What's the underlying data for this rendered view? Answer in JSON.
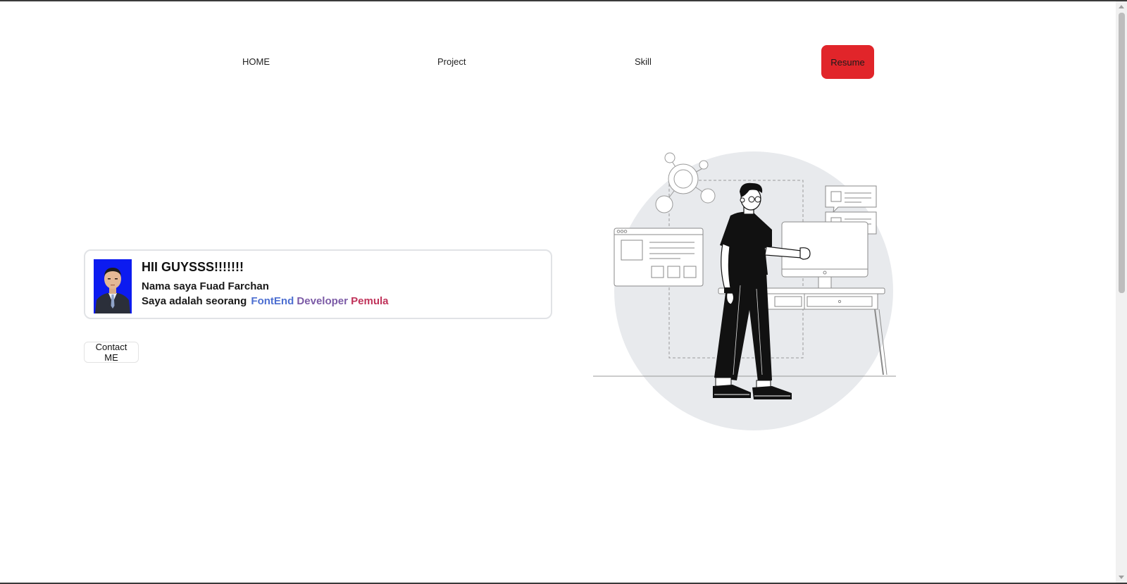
{
  "nav": {
    "home_label": "HOME",
    "project_label": "Project",
    "skill_label": "Skill",
    "resume_label": "Resume"
  },
  "intro": {
    "greeting": "HII GUYSSS!!!!!!!",
    "name_line": "Nama saya Fuad Farchan",
    "role_prefix": "Saya adalah seorang",
    "role_part1": "FontEnd",
    "role_part2": "Developer",
    "role_part3": "Pemula"
  },
  "contact": {
    "label": "Contact ME"
  },
  "colors": {
    "accent_red": "#e1252a",
    "role_blue": "#4d6fd1",
    "role_purple": "#7b5aa6",
    "role_pink": "#c0335a",
    "avatar_bg": "#0c1bf0"
  },
  "icons": {
    "avatar": "profile-photo",
    "hero": "developer-at-desk-illustration"
  }
}
